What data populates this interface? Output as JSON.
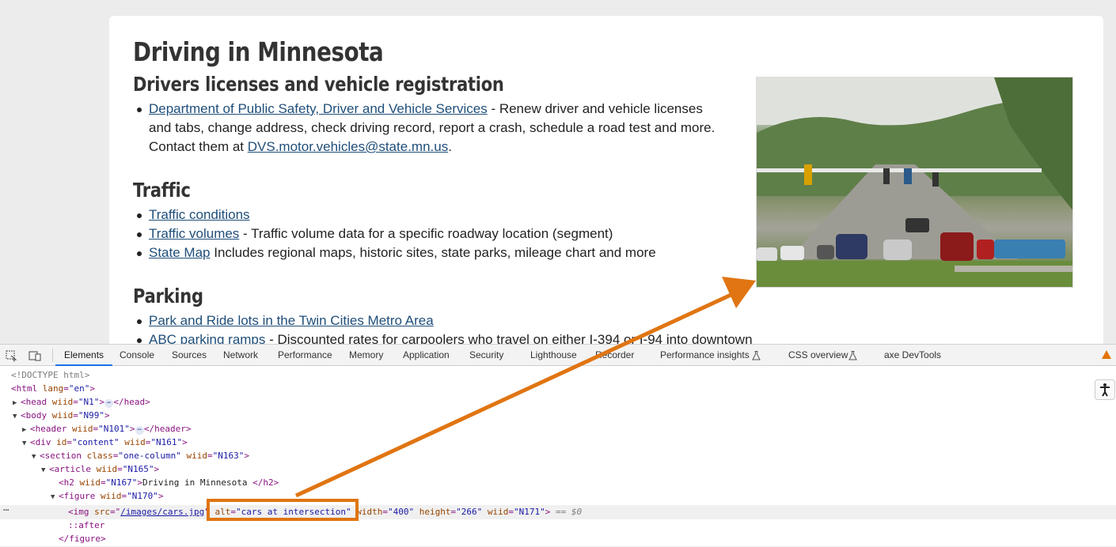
{
  "page": {
    "title": "Driving in Minnesota",
    "sections": {
      "licenses": {
        "heading": "Drivers licenses and vehicle registration",
        "items": [
          {
            "link": "Department of Public Safety, Driver and Vehicle Services",
            "text": " - Renew driver and vehicle licenses and tabs, change address, check driving record, report a crash, schedule a road test and more. Contact them at ",
            "email": "DVS.motor.vehicles@state.mn.us",
            "tail": "."
          }
        ]
      },
      "traffic": {
        "heading": "Traffic",
        "items": [
          {
            "link": "Traffic conditions",
            "text": ""
          },
          {
            "link": "Traffic volumes",
            "text": " - Traffic volume data for a specific roadway location (segment)"
          },
          {
            "link": "State Map",
            "text": " Includes regional maps, historic sites, state parks, mileage chart and more"
          }
        ]
      },
      "parking": {
        "heading": "Parking",
        "items": [
          {
            "link": "Park and Ride lots in the Twin Cities Metro Area",
            "text": ""
          },
          {
            "link": "ABC parking ramps",
            "text": " - Discounted rates for carpoolers who travel on either I-394 or I-94 into downtown"
          }
        ]
      }
    },
    "image_alt": "cars at intersection"
  },
  "devtools": {
    "tabs": [
      "Elements",
      "Console",
      "Sources",
      "Network",
      "Performance",
      "Memory",
      "Application",
      "Security",
      "Lighthouse",
      "Recorder",
      "Performance insights",
      "CSS overview",
      "axe DevTools"
    ],
    "active_tab": "Elements",
    "dom": {
      "doctype": "<!DOCTYPE html>",
      "html": {
        "tag": "html",
        "attr": "lang",
        "val": "\"en\""
      },
      "head": {
        "tag": "head",
        "attr": "wiid",
        "val": "\"N1\""
      },
      "body": {
        "tag": "body",
        "attr": "wiid",
        "val": "\"N99\""
      },
      "header": {
        "tag": "header",
        "attr": "wiid",
        "val": "\"N101\""
      },
      "div": {
        "tag": "div",
        "attr1": "id",
        "val1": "\"content\"",
        "attr2": "wiid",
        "val2": "\"N161\""
      },
      "section": {
        "tag": "section",
        "attr1": "class",
        "val1": "\"one-column\"",
        "attr2": "wiid",
        "val2": "\"N163\""
      },
      "article": {
        "tag": "article",
        "attr": "wiid",
        "val": "\"N165\""
      },
      "h2": {
        "tag": "h2",
        "attr": "wiid",
        "val": "\"N167\"",
        "text": "Driving in Minnesota "
      },
      "figure": {
        "tag": "figure",
        "attr": "wiid",
        "val": "\"N170\""
      },
      "img": {
        "src_attr": "src",
        "src_val": "/images/cars.jpg",
        "alt_attr": "alt",
        "alt_val": "\"cars at intersection\"",
        "w_attr": "width",
        "w_val": "\"400\"",
        "h_attr": "height",
        "h_val": "\"266\"",
        "wiid_attr": "wiid",
        "wiid_val": "\"N171\"",
        "selected_marker": "== $0"
      },
      "after": "::after",
      "figure_close": "</figure>"
    }
  },
  "colors": {
    "link": "#1f4e79",
    "annotation": "#e07512",
    "tag": "#881280",
    "attr_name": "#994500",
    "attr_value": "#1a1aa6"
  }
}
